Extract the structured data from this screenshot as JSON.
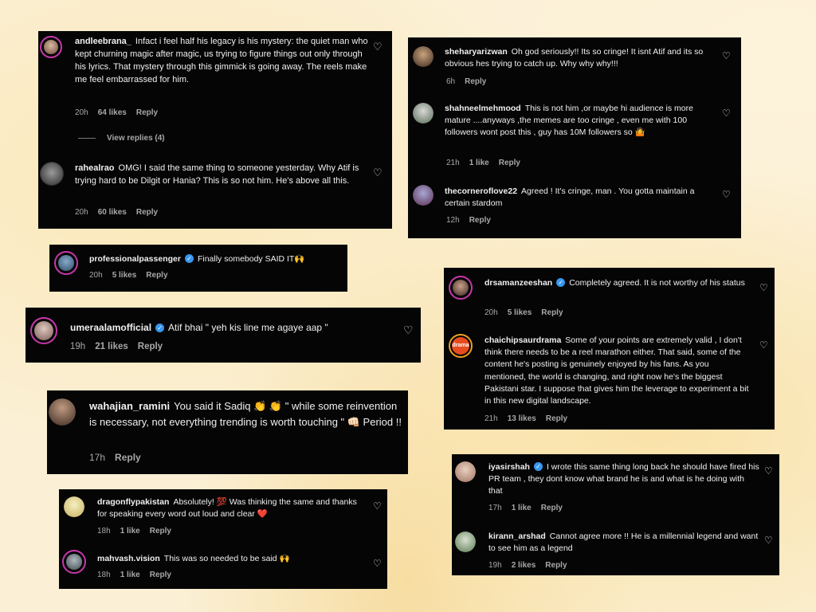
{
  "heart_glyph": "♡",
  "verified_glyph": "✓",
  "comments": {
    "andleebrana": {
      "username": "andleebrana_",
      "text": "Infact i feel half his legacy is his mystery: the quiet man who kept churning magic after magic, us trying to figure things out only through his lyrics. That mystery through this gimmick is going away. The reels make me feel embarrassed for him.",
      "time": "20h",
      "likes": "64 likes",
      "reply": "Reply",
      "view_replies": "View replies (4)"
    },
    "rahealrao": {
      "username": "rahealrao",
      "text": "OMG! I said the same thing to someone yesterday. Why Atif is trying hard to be Dilgit or Hania? This is so not him. He's above all this.",
      "time": "20h",
      "likes": "60 likes",
      "reply": "Reply"
    },
    "sheharyarizwan": {
      "username": "sheharyarizwan",
      "text": "Oh god seriously!! Its so cringe! It isnt Atif and its so obvious hes trying to catch up. Why why why!!!",
      "time": "6h",
      "reply": "Reply"
    },
    "shahneelmehmood": {
      "username": "shahneelmehmood",
      "text": "This is not him ,or maybe hi audience is more mature ....anyways ,the memes are too cringe , even me with 100 followers wont post this , guy has 10M followers so 🤷",
      "time": "21h",
      "likes": "1 like",
      "reply": "Reply"
    },
    "thecorneroflove22": {
      "username": "thecorneroflove22",
      "text": "Agreed ! It's cringe, man . You gotta maintain a certain stardom",
      "time": "12h",
      "reply": "Reply"
    },
    "professionalpassenger": {
      "username": "professionalpassenger",
      "text": "Finally somebody SAID IT🙌",
      "time": "20h",
      "likes": "5 likes",
      "reply": "Reply"
    },
    "drsamanzeeshan": {
      "username": "drsamanzeeshan",
      "text": "Completely agreed. It is not worthy of his status",
      "time": "20h",
      "likes": "5 likes",
      "reply": "Reply"
    },
    "umeraalamofficial": {
      "username": "umeraalamofficial",
      "text": "Atif bhai \" yeh kis line me agaye aap \"",
      "time": "19h",
      "likes": "21 likes",
      "reply": "Reply"
    },
    "chaichipsaurdrama": {
      "username": "chaichipsaurdrama",
      "avatar_text": "drama",
      "text": "Some of your points are extremely valid , I don't think there needs to be a reel marathon either. That said, some of the content he's posting is genuinely enjoyed by his fans. As you mentioned, the world is changing, and right now he's the biggest Pakistani star. I suppose that gives him the leverage to experiment a bit in this new digital landscape.",
      "time": "21h",
      "likes": "13 likes",
      "reply": "Reply"
    },
    "wahajian_ramini": {
      "username": "wahajian_ramini",
      "text": "You said it Sadiq 👏 👏 \" while some reinvention is necessary, not everything trending is worth touching \" 👊🏻 Period !!",
      "time": "17h",
      "reply": "Reply"
    },
    "iyasirshah": {
      "username": "iyasirshah",
      "text": "I wrote this same thing long back he should have fired his PR team , they dont know what brand he is and what is he doing with that",
      "time": "17h",
      "likes": "1 like",
      "reply": "Reply"
    },
    "kirann_arshad": {
      "username": "kirann_arshad",
      "text": "Cannot agree more !! He is a millennial legend and want to see him as a legend",
      "time": "19h",
      "likes": "2 likes",
      "reply": "Reply"
    },
    "dragonflypakistan": {
      "username": "dragonflypakistan",
      "text": "Absolutely! 💯 Was thinking the same and thanks for speaking every word out loud and clear ❤️",
      "time": "18h",
      "likes": "1 like",
      "reply": "Reply"
    },
    "mahvash": {
      "username": "mahvash.vision",
      "text": "This was so needed to be said 🙌",
      "time": "18h",
      "likes": "1 like",
      "reply": "Reply"
    }
  }
}
